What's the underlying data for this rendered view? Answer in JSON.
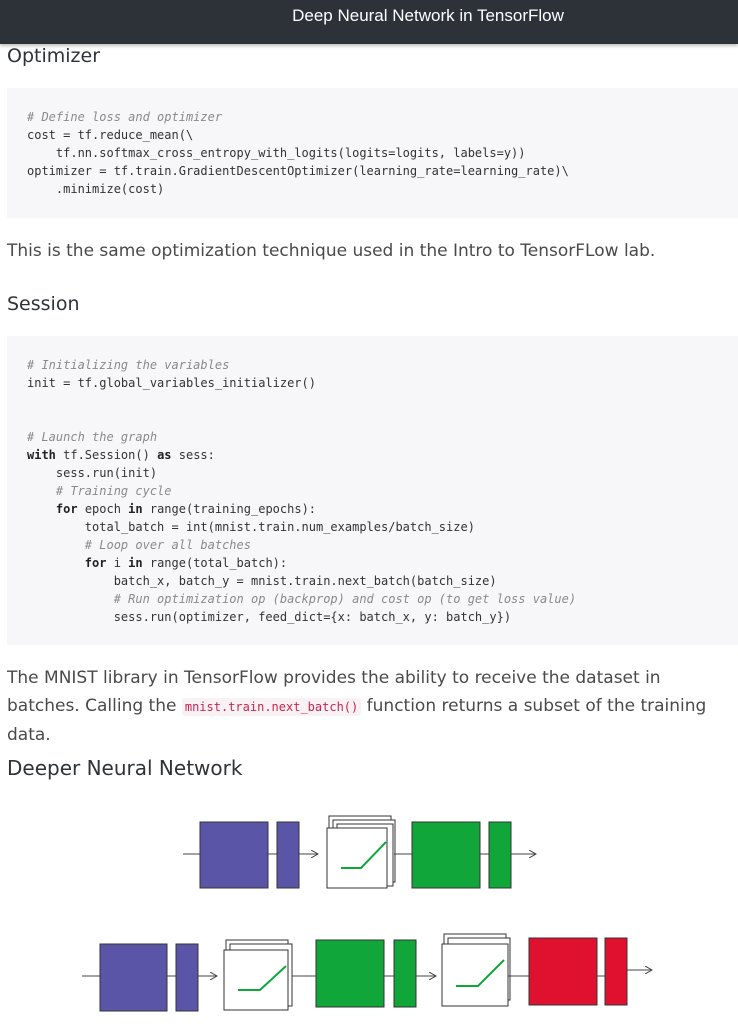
{
  "header": {
    "title": "Deep Neural Network in TensorFlow"
  },
  "sections": {
    "optimizer": {
      "heading": "Optimizer",
      "code": [
        "# Define loss and optimizer",
        "cost = tf.reduce_mean(\\",
        "    tf.nn.softmax_cross_entropy_with_logits(logits=logits, labels=y))",
        "optimizer = tf.train.GradientDescentOptimizer(learning_rate=learning_rate)\\",
        "    .minimize(cost)"
      ],
      "after_text": "This is the same optimization technique used in the Intro to TensorFLow lab."
    },
    "session": {
      "heading": "Session",
      "code": [
        "# Initializing the variables",
        "init = tf.global_variables_initializer()",
        "",
        "",
        "# Launch the graph",
        "with tf.Session() as sess:",
        "    sess.run(init)",
        "    # Training cycle",
        "    for epoch in range(training_epochs):",
        "        total_batch = int(mnist.train.num_examples/batch_size)",
        "        # Loop over all batches",
        "        for i in range(total_batch):",
        "            batch_x, batch_y = mnist.train.next_batch(batch_size)",
        "            # Run optimization op (backprop) and cost op (to get loss value)",
        "            sess.run(optimizer, feed_dict={x: batch_x, y: batch_y})"
      ],
      "after_text_1": "The MNIST library in TensorFlow provides the ability to receive the dataset in batches. Calling the",
      "after_code": "mnist.train.next_batch()",
      "after_text_2": "function returns a subset of the training data."
    },
    "deeper": {
      "heading": "Deeper Neural Network"
    }
  },
  "colors": {
    "blue": "#5b55a8",
    "green": "#10a63a",
    "red": "#e0102f",
    "dark": "#2c3238"
  }
}
